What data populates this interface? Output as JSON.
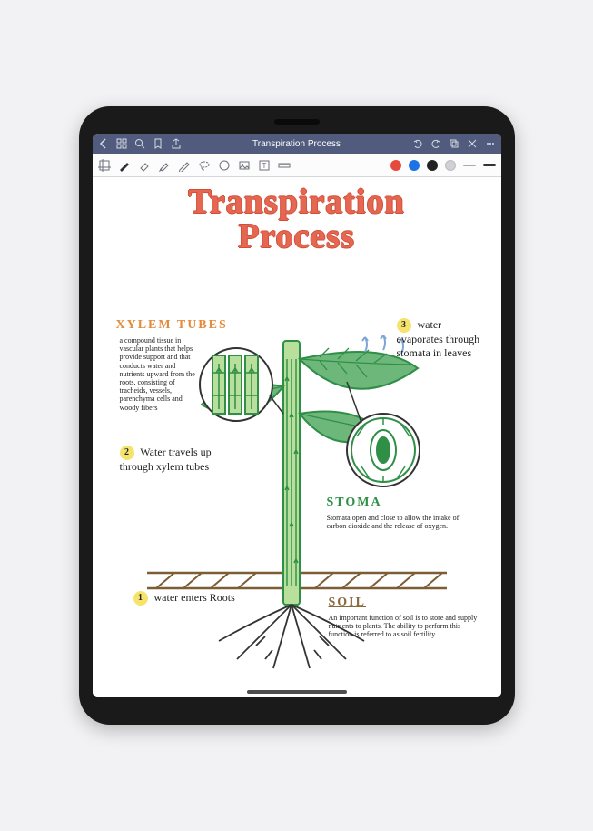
{
  "navbar": {
    "title": "Transpiration Process",
    "icons_left": [
      "back",
      "grid",
      "search",
      "bookmark",
      "share"
    ],
    "icons_right": [
      "undo",
      "redo",
      "copy",
      "close",
      "more"
    ]
  },
  "toolbar": {
    "tools": [
      "crop",
      "pen",
      "eraser",
      "highlighter",
      "pencil",
      "lasso",
      "circle",
      "image",
      "text",
      "ruler"
    ],
    "colors": [
      "red",
      "blue",
      "black",
      "grey"
    ],
    "strokes": [
      "thin",
      "med"
    ]
  },
  "page": {
    "title_line1": "Transpiration",
    "title_line2": "Process",
    "labels": {
      "xylem_heading": "XYLEM TUBES",
      "xylem_desc": "a compound tissue in vascular plants that helps provide support and that conducts water and nutrients upward from the roots, consisting of tracheids, vessels, parenchyma cells and woody fibers",
      "step2": "Water travels up through xylem tubes",
      "step1": "water enters Roots",
      "stoma_heading": "STOMA",
      "stoma_desc": "Stomata open and close to allow the intake of carbon dioxide and the release of oxygen.",
      "step3": "water evaporates through stomata in leaves",
      "soil_heading": "SOIL",
      "soil_desc": "An important function of soil is to store and supply nutrients to plants. The ability to perform this function is referred to as soil fertility."
    },
    "steps": {
      "s1": "1",
      "s2": "2",
      "s3": "3"
    }
  }
}
